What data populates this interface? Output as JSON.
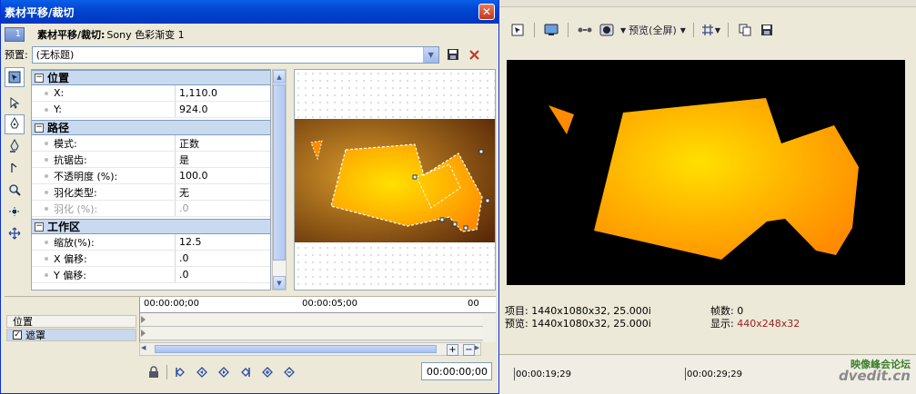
{
  "dialog": {
    "title": "素材平移/裁切",
    "close_glyph": "✕",
    "event_number": "1",
    "event_prefix": "素材平移/裁切:",
    "event_name": "Sony 色彩渐变 1"
  },
  "preset": {
    "label": "预置:",
    "value": "(无标题)"
  },
  "properties": {
    "position": {
      "header": "位置",
      "toggle": "−",
      "rows": [
        {
          "name": "X:",
          "value": "1,110.0"
        },
        {
          "name": "Y:",
          "value": "924.0"
        }
      ]
    },
    "path": {
      "header": "路径",
      "toggle": "−",
      "rows": [
        {
          "name": "模式:",
          "value": "正数"
        },
        {
          "name": "抗锯齿:",
          "value": "是"
        },
        {
          "name": "不透明度 (%):",
          "value": "100.0"
        },
        {
          "name": "羽化类型:",
          "value": "无"
        },
        {
          "name": "羽化 (%):",
          "value": ".0"
        }
      ]
    },
    "workspace": {
      "header": "工作区",
      "toggle": "−",
      "rows": [
        {
          "name": "缩放(%):",
          "value": "12.5"
        },
        {
          "name": "X 偏移:",
          "value": ".0"
        },
        {
          "name": "Y 偏移:",
          "value": ".0"
        }
      ]
    }
  },
  "keyframes": {
    "tracks": [
      {
        "label": "位置"
      },
      {
        "label": "遮罩",
        "checked": "✓"
      }
    ],
    "ruler": [
      "00:00:00;00",
      "00:00:05;00",
      "00"
    ],
    "zoom_in": "+",
    "zoom_out": "−",
    "current_time": "00:00:00;00"
  },
  "preview": {
    "toolbar_mode": "预览(全屏)",
    "info": {
      "project": "项目: 1440x1080x32, 25.000i",
      "preview": "预览: 1440x1080x32, 25.000i",
      "frames": "帧数: 0",
      "display_label": "显示: ",
      "display_value": "440x248x32"
    },
    "timeline_marks": [
      "00:00:19;29",
      "00:00:29;29"
    ],
    "watermark_cn": "映像峰会论坛",
    "watermark_url": "dvedit.cn"
  },
  "colors": {
    "titlebar": "#0246d0",
    "display_value": "#9a1e1e",
    "shape_orange": "#ff9a00",
    "shape_yellow": "#ffe000"
  }
}
